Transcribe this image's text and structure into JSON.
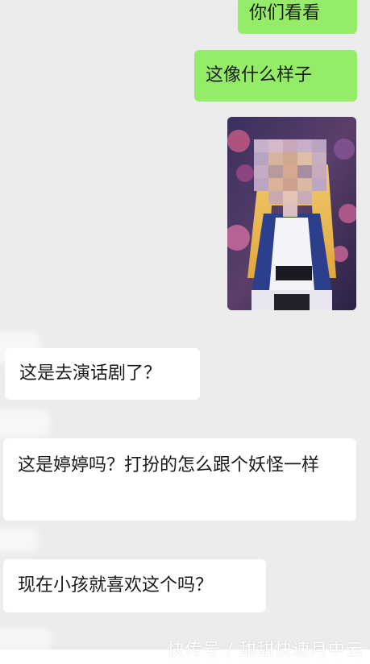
{
  "messages": {
    "sent_1": "你们看看",
    "sent_2": "这像什么样子",
    "recv_1": "这是去演话剧了？",
    "recv_2": "这是婷婷吗？打扮的怎么跟个妖怪一样",
    "recv_3": "现在小孩就喜欢这个吗？"
  },
  "watermark": "快传号 / 甜甜快速月中云",
  "colors": {
    "sent_bubble": "#95ec69",
    "received_bubble": "#ffffff",
    "background": "#ececec"
  }
}
